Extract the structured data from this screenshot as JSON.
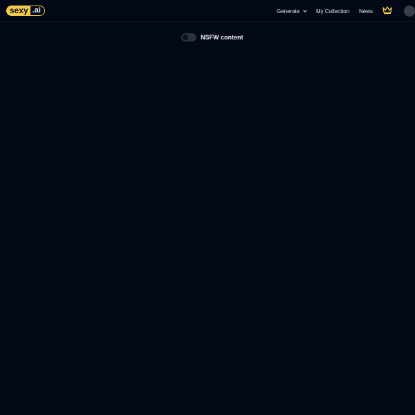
{
  "brand": {
    "name": "sexy",
    "tld": ".ai"
  },
  "nav": {
    "generate": "Generate",
    "collection": "My Collection",
    "news": "News"
  },
  "icons": {
    "crown": "crown-icon",
    "chevron": "chevron-down-icon"
  },
  "settings": {
    "nsfw_label": "NSFW content",
    "nsfw_enabled": false
  },
  "colors": {
    "background": "#030817",
    "accent": "#f2c94c"
  }
}
